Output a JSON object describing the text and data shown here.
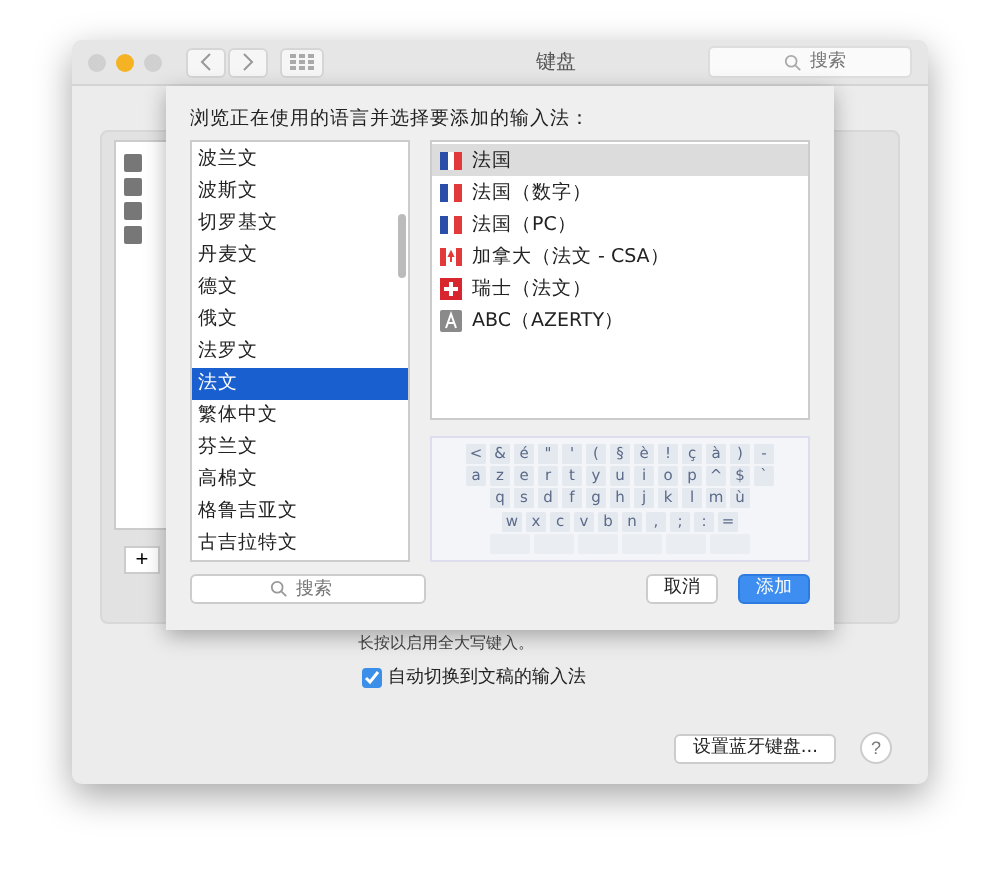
{
  "window": {
    "title": "键盘",
    "search_placeholder": "搜索"
  },
  "sheet": {
    "prompt": "浏览正在使用的语言并选择要添加的输入法：",
    "languages": [
      {
        "label": "波兰文",
        "selected": false
      },
      {
        "label": "波斯文",
        "selected": false
      },
      {
        "label": "切罗基文",
        "selected": false
      },
      {
        "label": "丹麦文",
        "selected": false
      },
      {
        "label": "德文",
        "selected": false
      },
      {
        "label": "俄文",
        "selected": false
      },
      {
        "label": "法罗文",
        "selected": false
      },
      {
        "label": "法文",
        "selected": true
      },
      {
        "label": "繁体中文",
        "selected": false
      },
      {
        "label": "芬兰文",
        "selected": false
      },
      {
        "label": "高棉文",
        "selected": false
      },
      {
        "label": "格鲁吉亚文",
        "selected": false
      },
      {
        "label": "古吉拉特文",
        "selected": false
      }
    ],
    "input_sources": [
      {
        "label": "法国",
        "kind": "fr",
        "selected": true
      },
      {
        "label": "法国（数字）",
        "kind": "fr",
        "selected": false
      },
      {
        "label": "法国（PC）",
        "kind": "fr",
        "selected": false
      },
      {
        "label": "加拿大（法文 - CSA）",
        "kind": "ca",
        "selected": false
      },
      {
        "label": "瑞士（法文）",
        "kind": "ch",
        "selected": false
      },
      {
        "label": "ABC（AZERTY）",
        "kind": "abc",
        "selected": false
      }
    ],
    "keyboard_rows": [
      [
        "<",
        "&",
        "é",
        "\"",
        "'",
        "(",
        "§",
        "è",
        "!",
        "ç",
        "à",
        ")",
        "-"
      ],
      [
        "a",
        "z",
        "e",
        "r",
        "t",
        "y",
        "u",
        "i",
        "o",
        "p",
        "^",
        "$",
        "`"
      ],
      [
        "q",
        "s",
        "d",
        "f",
        "g",
        "h",
        "j",
        "k",
        "l",
        "m",
        "ù"
      ],
      [
        "w",
        "x",
        "c",
        "v",
        "b",
        "n",
        ",",
        ";",
        ":",
        "="
      ]
    ],
    "search_placeholder": "搜索",
    "cancel": "取消",
    "add": "添加"
  },
  "background": {
    "caps_hint": "长按以启用全大写键入。",
    "auto_switch": {
      "label": "自动切换到文稿的输入法",
      "checked": true
    },
    "bluetooth_button": "设置蓝牙键盘...",
    "help": "?",
    "add_symbol": "+"
  }
}
